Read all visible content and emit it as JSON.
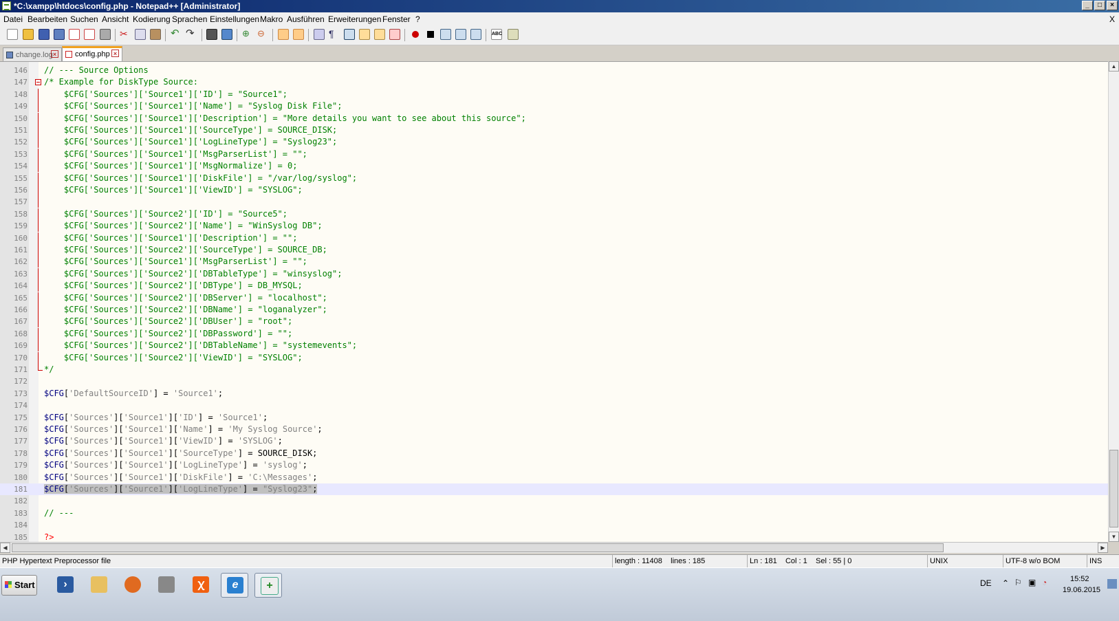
{
  "window": {
    "title": "*C:\\xampp\\htdocs\\config.php - Notepad++ [Administrator]"
  },
  "menu": [
    "Datei",
    "Bearbeiten",
    "Suchen",
    "Ansicht",
    "Kodierung",
    "Sprachen",
    "Einstellungen",
    "Makro",
    "Ausführen",
    "Erweiterungen",
    "Fenster",
    "?"
  ],
  "menu_close": "X",
  "tabs": [
    {
      "label": "change.log",
      "active": false
    },
    {
      "label": "config.php",
      "active": true
    }
  ],
  "editor": {
    "lines": [
      {
        "n": "146",
        "t": "// --- Source Options"
      },
      {
        "n": "147",
        "t": "/* Example for DiskType Source:"
      },
      {
        "n": "148",
        "t": "    $CFG['Sources']['Source1']['ID'] = \"Source1\";"
      },
      {
        "n": "149",
        "t": "    $CFG['Sources']['Source1']['Name'] = \"Syslog Disk File\";"
      },
      {
        "n": "150",
        "t": "    $CFG['Sources']['Source1']['Description'] = \"More details you want to see about this source\";"
      },
      {
        "n": "151",
        "t": "    $CFG['Sources']['Source1']['SourceType'] = SOURCE_DISK;"
      },
      {
        "n": "152",
        "t": "    $CFG['Sources']['Source1']['LogLineType'] = \"Syslog23\";"
      },
      {
        "n": "153",
        "t": "    $CFG['Sources']['Source1']['MsgParserList'] = \"\";"
      },
      {
        "n": "154",
        "t": "    $CFG['Sources']['Source1']['MsgNormalize'] = 0;"
      },
      {
        "n": "155",
        "t": "    $CFG['Sources']['Source1']['DiskFile'] = \"/var/log/syslog\";"
      },
      {
        "n": "156",
        "t": "    $CFG['Sources']['Source1']['ViewID'] = \"SYSLOG\";"
      },
      {
        "n": "157",
        "t": ""
      },
      {
        "n": "158",
        "t": "    $CFG['Sources']['Source2']['ID'] = \"Source5\";"
      },
      {
        "n": "159",
        "t": "    $CFG['Sources']['Source2']['Name'] = \"WinSyslog DB\";"
      },
      {
        "n": "160",
        "t": "    $CFG['Sources']['Source1']['Description'] = \"\";"
      },
      {
        "n": "161",
        "t": "    $CFG['Sources']['Source2']['SourceType'] = SOURCE_DB;"
      },
      {
        "n": "162",
        "t": "    $CFG['Sources']['Source1']['MsgParserList'] = \"\";"
      },
      {
        "n": "163",
        "t": "    $CFG['Sources']['Source2']['DBTableType'] = \"winsyslog\";"
      },
      {
        "n": "164",
        "t": "    $CFG['Sources']['Source2']['DBType'] = DB_MYSQL;"
      },
      {
        "n": "165",
        "t": "    $CFG['Sources']['Source2']['DBServer'] = \"localhost\";"
      },
      {
        "n": "166",
        "t": "    $CFG['Sources']['Source2']['DBName'] = \"loganalyzer\";"
      },
      {
        "n": "167",
        "t": "    $CFG['Sources']['Source2']['DBUser'] = \"root\";"
      },
      {
        "n": "168",
        "t": "    $CFG['Sources']['Source2']['DBPassword'] = \"\";"
      },
      {
        "n": "169",
        "t": "    $CFG['Sources']['Source2']['DBTableName'] = \"systemevents\";"
      },
      {
        "n": "170",
        "t": "    $CFG['Sources']['Source2']['ViewID'] = \"SYSLOG\";"
      },
      {
        "n": "171",
        "t": "*/"
      },
      {
        "n": "172",
        "t": ""
      },
      {
        "n": "173",
        "t": "$CFG['DefaultSourceID'] = 'Source1';"
      },
      {
        "n": "174",
        "t": ""
      },
      {
        "n": "175",
        "t": "$CFG['Sources']['Source1']['ID'] = 'Source1';"
      },
      {
        "n": "176",
        "t": "$CFG['Sources']['Source1']['Name'] = 'My Syslog Source';"
      },
      {
        "n": "177",
        "t": "$CFG['Sources']['Source1']['ViewID'] = 'SYSLOG';"
      },
      {
        "n": "178",
        "t": "$CFG['Sources']['Source1']['SourceType'] = SOURCE_DISK;"
      },
      {
        "n": "179",
        "t": "$CFG['Sources']['Source1']['LogLineType'] = 'syslog';"
      },
      {
        "n": "180",
        "t": "$CFG['Sources']['Source1']['DiskFile'] = 'C:\\Messages';"
      },
      {
        "n": "181",
        "t": "$CFG['Sources']['Source1']['LogLineType'] = \"Syslog23\";"
      },
      {
        "n": "182",
        "t": ""
      },
      {
        "n": "183",
        "t": "// ---"
      },
      {
        "n": "184",
        "t": ""
      },
      {
        "n": "185",
        "t": "?>"
      }
    ],
    "current_line": "181"
  },
  "status": {
    "filetype": "PHP Hypertext Preprocessor file",
    "length": "length : 11408    lines : 185",
    "position": "Ln : 181    Col : 1    Sel : 55 | 0",
    "eol": "UNIX",
    "encoding": "UTF-8 w/o BOM",
    "mode": "INS"
  },
  "taskbar": {
    "start_label": "Start",
    "language": "DE",
    "time": "15:52",
    "date": "19.06.2015"
  },
  "colors": {
    "title_start": "#0a246a",
    "title_end": "#3a6ea5",
    "comment": "#008000",
    "string": "#808080",
    "variable": "#000080",
    "php_tag": "#ff0000",
    "selection": "#c0c0c0",
    "current_line": "#e8e8ff"
  }
}
